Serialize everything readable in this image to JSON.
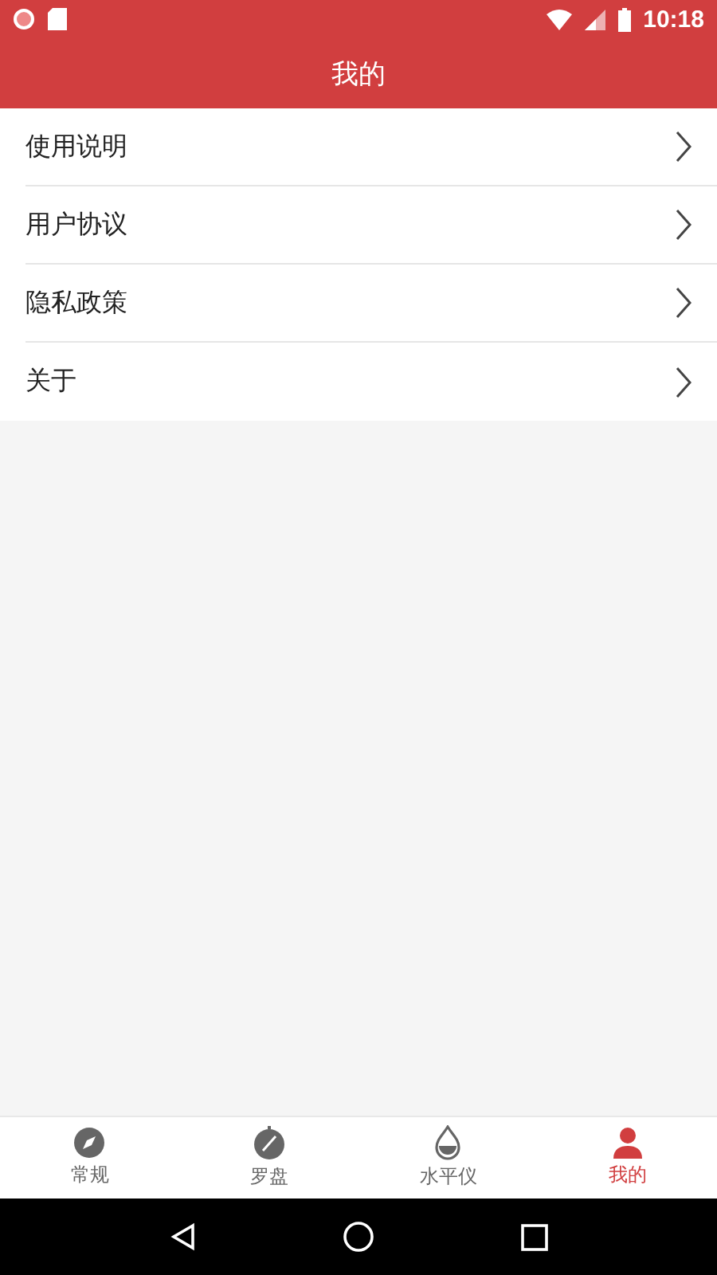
{
  "status_bar": {
    "time": "10:18"
  },
  "toolbar": {
    "title": "我的"
  },
  "menu": [
    {
      "label": "使用说明"
    },
    {
      "label": "用户协议"
    },
    {
      "label": "隐私政策"
    },
    {
      "label": "关于"
    }
  ],
  "tabs": [
    {
      "kind": "compass",
      "label": "常规",
      "selected": false
    },
    {
      "kind": "dial",
      "label": "罗盘",
      "selected": false
    },
    {
      "kind": "drop",
      "label": "水平仪",
      "selected": false
    },
    {
      "kind": "person",
      "label": "我的",
      "selected": true
    }
  ]
}
